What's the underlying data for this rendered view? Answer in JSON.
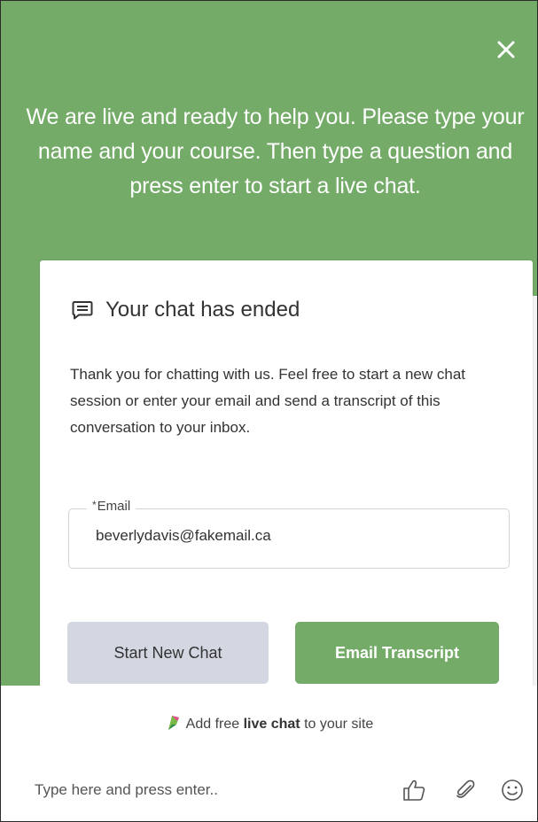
{
  "header": {
    "message": "We are live and ready to help you. Please type your name and your course. Then type a question and press enter to start a live chat."
  },
  "card": {
    "title": "Your chat has ended",
    "body": "Thank you for chatting with us. Feel free to start a new chat session or enter your email and send a transcript of this conversation to your inbox.",
    "email_required_mark": "*",
    "email_label": "Email",
    "email_value": "beverlydavis@fakemail.ca",
    "start_new_chat_label": "Start New Chat",
    "email_transcript_label": "Email Transcript"
  },
  "footer": {
    "promo_prefix": "Add free ",
    "promo_bold": "live chat",
    "promo_suffix": " to your site",
    "composer_placeholder": "Type here and press enter.."
  },
  "colors": {
    "accent": "#74ab68",
    "secondary_button": "#d3d7e2"
  },
  "icons": [
    "close-icon",
    "chat-bubble-icon",
    "tawk-logo-icon",
    "thumbs-up-icon",
    "paperclip-icon",
    "smiley-icon"
  ]
}
